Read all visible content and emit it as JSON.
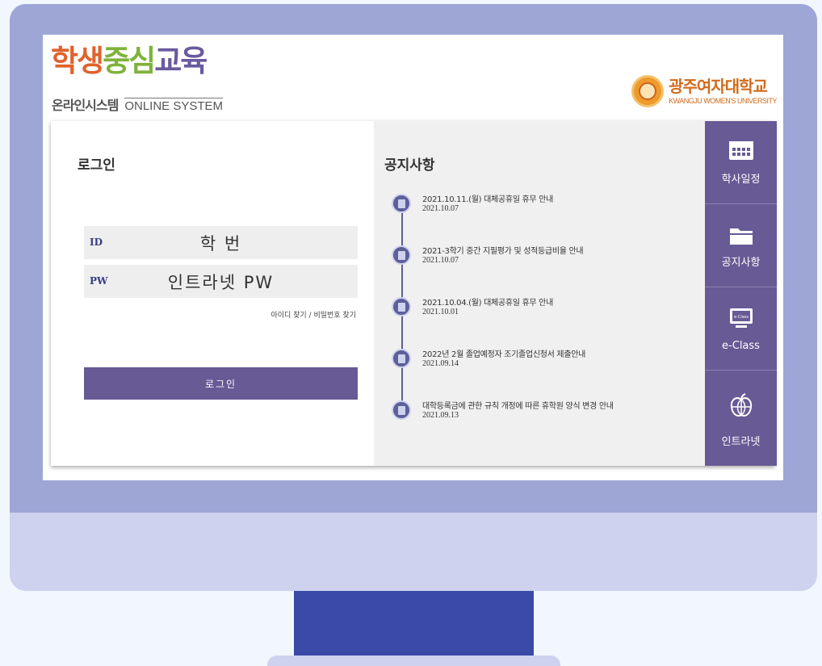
{
  "header": {
    "logo": {
      "part1": "학생",
      "part2": "중심",
      "part3": "교육",
      "sub_kr": "온라인시스템",
      "sub_en": "ONLINE SYSTEM"
    },
    "university": {
      "name_kr": "광주여자대학교",
      "name_en": "KWANGJU WOMEN'S UNIVERSITY"
    }
  },
  "login": {
    "title": "로그인",
    "id_label": "ID",
    "id_value": "학 번",
    "pw_label": "PW",
    "pw_value": "인트라넷 PW",
    "find_link": "아이디 찾기 / 비밀번호 찾기",
    "button": "로그인"
  },
  "notice": {
    "title": "공지사항",
    "items": [
      {
        "title": "2021.10.11.(월) 대체공휴일 휴무 안내",
        "date": "2021.10.07"
      },
      {
        "title": "2021-3학기 중간 지필평가 및 성적등급비율 안내",
        "date": "2021.10.07"
      },
      {
        "title": "2021.10.04.(월) 대체공휴일 휴무 안내",
        "date": "2021.10.01"
      },
      {
        "title": "2022년 2월 졸업예정자 조기졸업신청서 제출안내",
        "date": "2021.09.14"
      },
      {
        "title": "대학등록금에 관한 규칙 개정에 따른 휴학원 양식 변경 안내",
        "date": "2021.09.13"
      }
    ]
  },
  "sidebar": {
    "items": [
      {
        "label": "학사일정",
        "icon": "calendar-icon"
      },
      {
        "label": "공지사항",
        "icon": "folder-icon"
      },
      {
        "label": "e-Class",
        "icon": "monitor-icon",
        "icon_text": "e-Class"
      },
      {
        "label": "인트라넷",
        "icon": "globe-apple-icon"
      }
    ]
  },
  "colors": {
    "accent": "#675a95",
    "bezel": "#9ea6d6",
    "stand": "#3a4aa6",
    "logo_orange": "#e0622c",
    "logo_green": "#7fb23b"
  }
}
